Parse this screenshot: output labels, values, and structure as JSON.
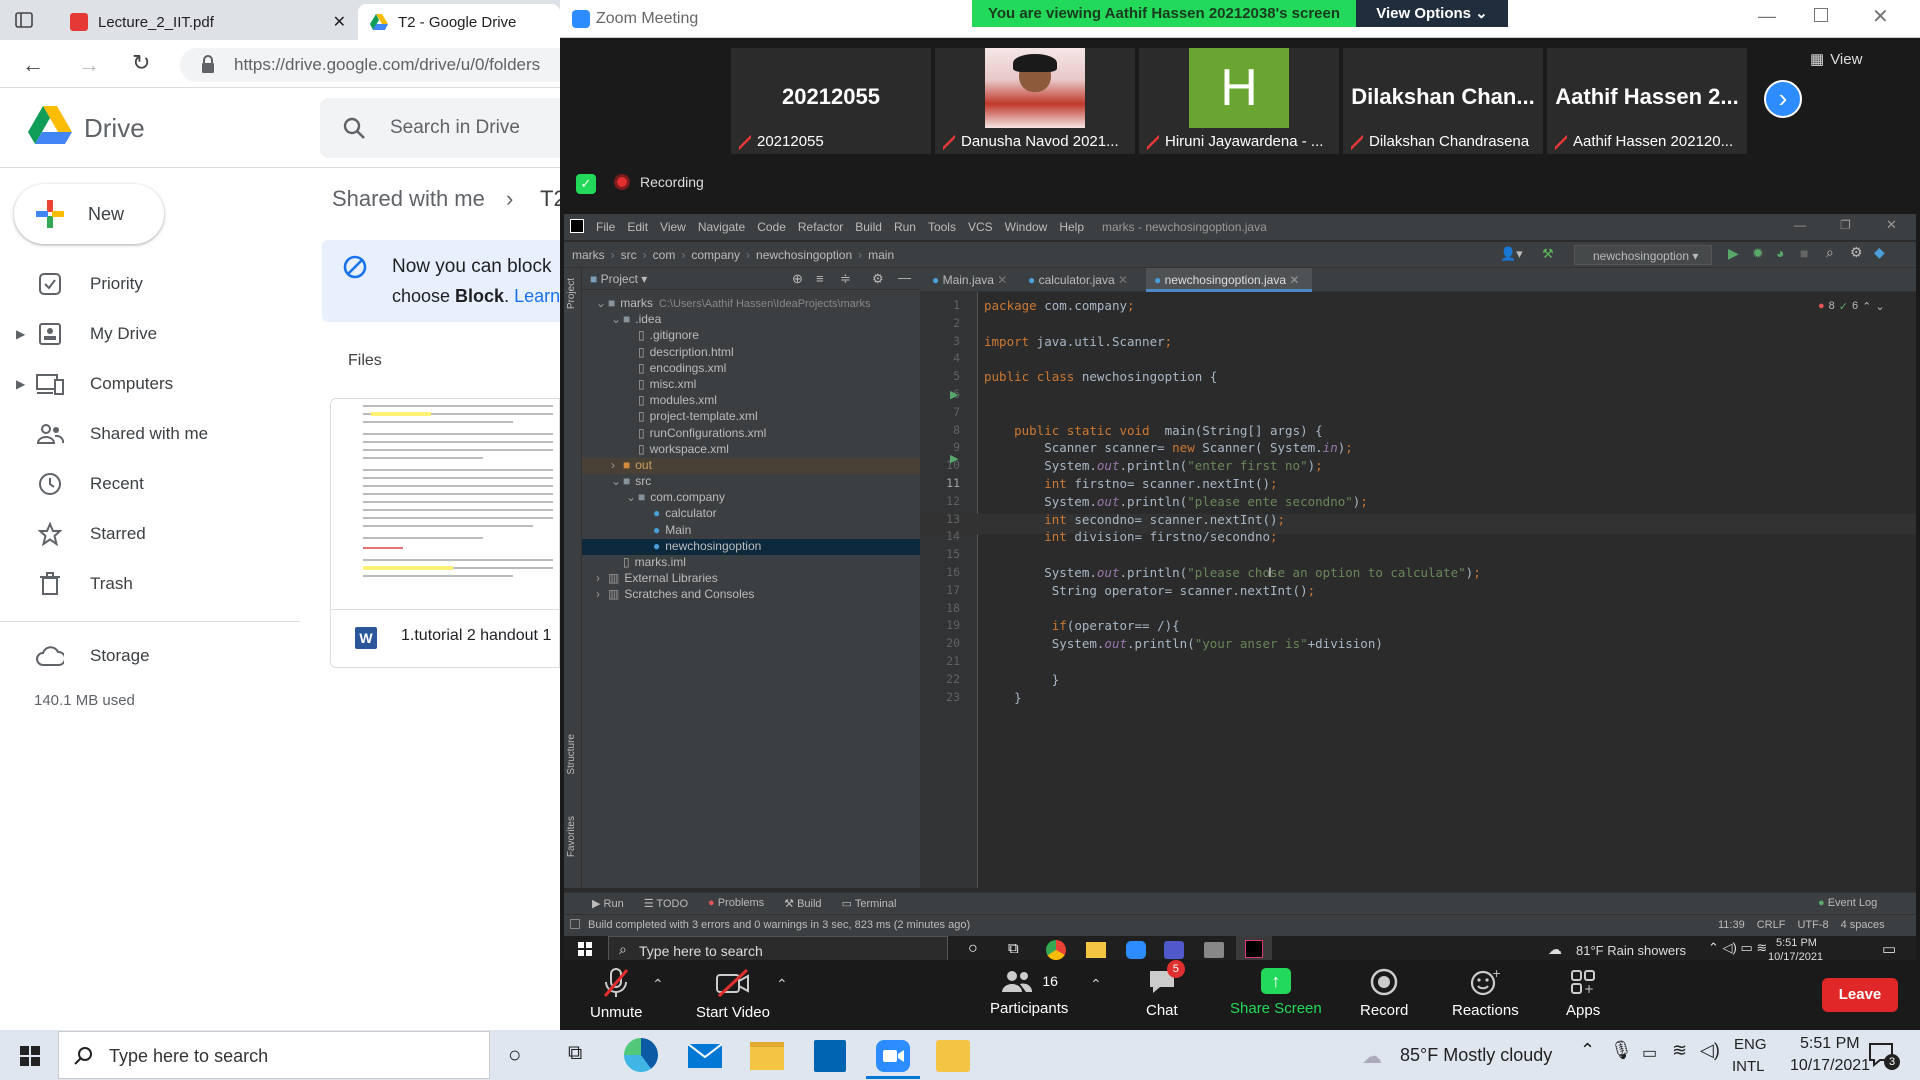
{
  "browser": {
    "tabs": [
      {
        "label": "Lecture_2_IIT.pdf",
        "icon": "pdf-icon"
      },
      {
        "label": "T2 - Google Drive",
        "icon": "drive-icon"
      }
    ],
    "url": "https://drive.google.com/drive/u/0/folders"
  },
  "drive": {
    "app_name": "Drive",
    "search_placeholder": "Search in Drive",
    "new_label": "New",
    "breadcrumb": {
      "root": "Shared with me",
      "current": "T2"
    },
    "nav": [
      {
        "label": "Priority",
        "icon": "priority-check-icon"
      },
      {
        "label": "My Drive",
        "icon": "my-drive-icon"
      },
      {
        "label": "Computers",
        "icon": "computer-icon"
      },
      {
        "label": "Shared with me",
        "icon": "shared-people-icon"
      },
      {
        "label": "Recent",
        "icon": "clock-icon"
      },
      {
        "label": "Starred",
        "icon": "star-icon"
      },
      {
        "label": "Trash",
        "icon": "trash-icon"
      }
    ],
    "storage_label": "Storage",
    "storage_used": "140.1 MB used",
    "banner_line1": "Now you can block",
    "banner_line2_pre": "choose ",
    "banner_line2_bold": "Block",
    "banner_line2_link": "Learn",
    "files_heading": "Files",
    "file_name": "1.tutorial 2 handout 1"
  },
  "zoom": {
    "window_title": "Zoom Meeting",
    "viewing_banner": "You are viewing Aathif Hassen 20212038's screen",
    "view_options": "View Options",
    "view_label": "View",
    "recording_label": "Recording",
    "participants": [
      {
        "display": "20212055",
        "label": "20212055"
      },
      {
        "display": "",
        "label": "Danusha Navod 2021..."
      },
      {
        "display": "H",
        "label": "Hiruni Jayawardena - ..."
      },
      {
        "display": "Dilakshan  Chan...",
        "label": "Dilakshan Chandrasena"
      },
      {
        "display": "Aathif  Hassen  2...",
        "label": "Aathif Hassen 202120..."
      }
    ],
    "toolbar": {
      "unmute": "Unmute",
      "start_video": "Start Video",
      "participants": "Participants",
      "participants_count": "16",
      "chat": "Chat",
      "chat_badge": "5",
      "share_screen": "Share Screen",
      "record": "Record",
      "reactions": "Reactions",
      "apps": "Apps",
      "leave": "Leave"
    }
  },
  "ide": {
    "menu": [
      "File",
      "Edit",
      "View",
      "Navigate",
      "Code",
      "Refactor",
      "Build",
      "Run",
      "Tools",
      "VCS",
      "Window",
      "Help"
    ],
    "title": "marks - newchosingoption.java",
    "breadcrumb": [
      "marks",
      "src",
      "com",
      "company",
      "newchosingoption",
      "main"
    ],
    "run_config": "newchosingoption",
    "project_label": "Project",
    "editor_tabs": [
      "Main.java",
      "calculator.java",
      "newchosingoption.java"
    ],
    "inspection": {
      "errors": "8",
      "warnings": "6"
    },
    "tree": [
      {
        "label": "marks",
        "path": "C:\\Users\\Aathif Hassen\\IdeaProjects\\marks",
        "depth": 0,
        "type": "folder"
      },
      {
        "label": ".idea",
        "depth": 1,
        "type": "folder"
      },
      {
        "label": ".gitignore",
        "depth": 2,
        "type": "file"
      },
      {
        "label": "description.html",
        "depth": 2,
        "type": "file"
      },
      {
        "label": "encodings.xml",
        "depth": 2,
        "type": "file"
      },
      {
        "label": "misc.xml",
        "depth": 2,
        "type": "file"
      },
      {
        "label": "modules.xml",
        "depth": 2,
        "type": "file"
      },
      {
        "label": "project-template.xml",
        "depth": 2,
        "type": "file"
      },
      {
        "label": "runConfigurations.xml",
        "depth": 2,
        "type": "file"
      },
      {
        "label": "workspace.xml",
        "depth": 2,
        "type": "file"
      },
      {
        "label": "out",
        "depth": 1,
        "type": "folder-orange"
      },
      {
        "label": "src",
        "depth": 1,
        "type": "folder"
      },
      {
        "label": "com.company",
        "depth": 2,
        "type": "folder"
      },
      {
        "label": "calculator",
        "depth": 3,
        "type": "class"
      },
      {
        "label": "Main",
        "depth": 3,
        "type": "class"
      },
      {
        "label": "newchosingoption",
        "depth": 3,
        "type": "class"
      },
      {
        "label": "marks.iml",
        "depth": 1,
        "type": "file"
      },
      {
        "label": "External Libraries",
        "depth": 0,
        "type": "lib"
      },
      {
        "label": "Scratches and Consoles",
        "depth": 0,
        "type": "lib"
      }
    ],
    "code": [
      "package com.company;",
      "",
      "import java.util.Scanner;",
      "",
      "public class newchosingoption {",
      "",
      "",
      "    public static void  main(String[] args) {",
      "        Scanner scanner= new Scanner( System.in);",
      "        System.out.println(\"enter first no\");",
      "        int firstno= scanner.nextInt();",
      "        System.out.println(\"please ente secondno\");",
      "        int secondno= scanner.nextInt();",
      "        int division= firstno/secondno;",
      "",
      "        System.out.println(\"please chose an option to calculate\");",
      "         String operator= scanner.nextInt();",
      "",
      "         if(operator== /){",
      "         System.out.println(\"your anser is\"+division)",
      "",
      "         }",
      "    }"
    ],
    "bottom_tools": [
      "Run",
      "TODO",
      "Problems",
      "Build",
      "Terminal"
    ],
    "event_log": "Event Log",
    "status_msg": "Build completed with 3 errors and 0 warnings in 3 sec, 823 ms (2 minutes ago)",
    "status_right": [
      "11:39",
      "CRLF",
      "UTF-8",
      "4 spaces"
    ],
    "sidebar_labels": [
      "Project",
      "Structure",
      "Favorites"
    ]
  },
  "inner_taskbar": {
    "search": "Type here to search",
    "weather": "81°F  Rain showers",
    "time": "5:51 PM",
    "date": "10/17/2021"
  },
  "taskbar": {
    "search": "Type here to search",
    "weather": "85°F  Mostly cloudy",
    "lang1": "ENG",
    "lang2": "INTL",
    "time": "5:51 PM",
    "date": "10/17/2021",
    "notif_count": "3"
  }
}
